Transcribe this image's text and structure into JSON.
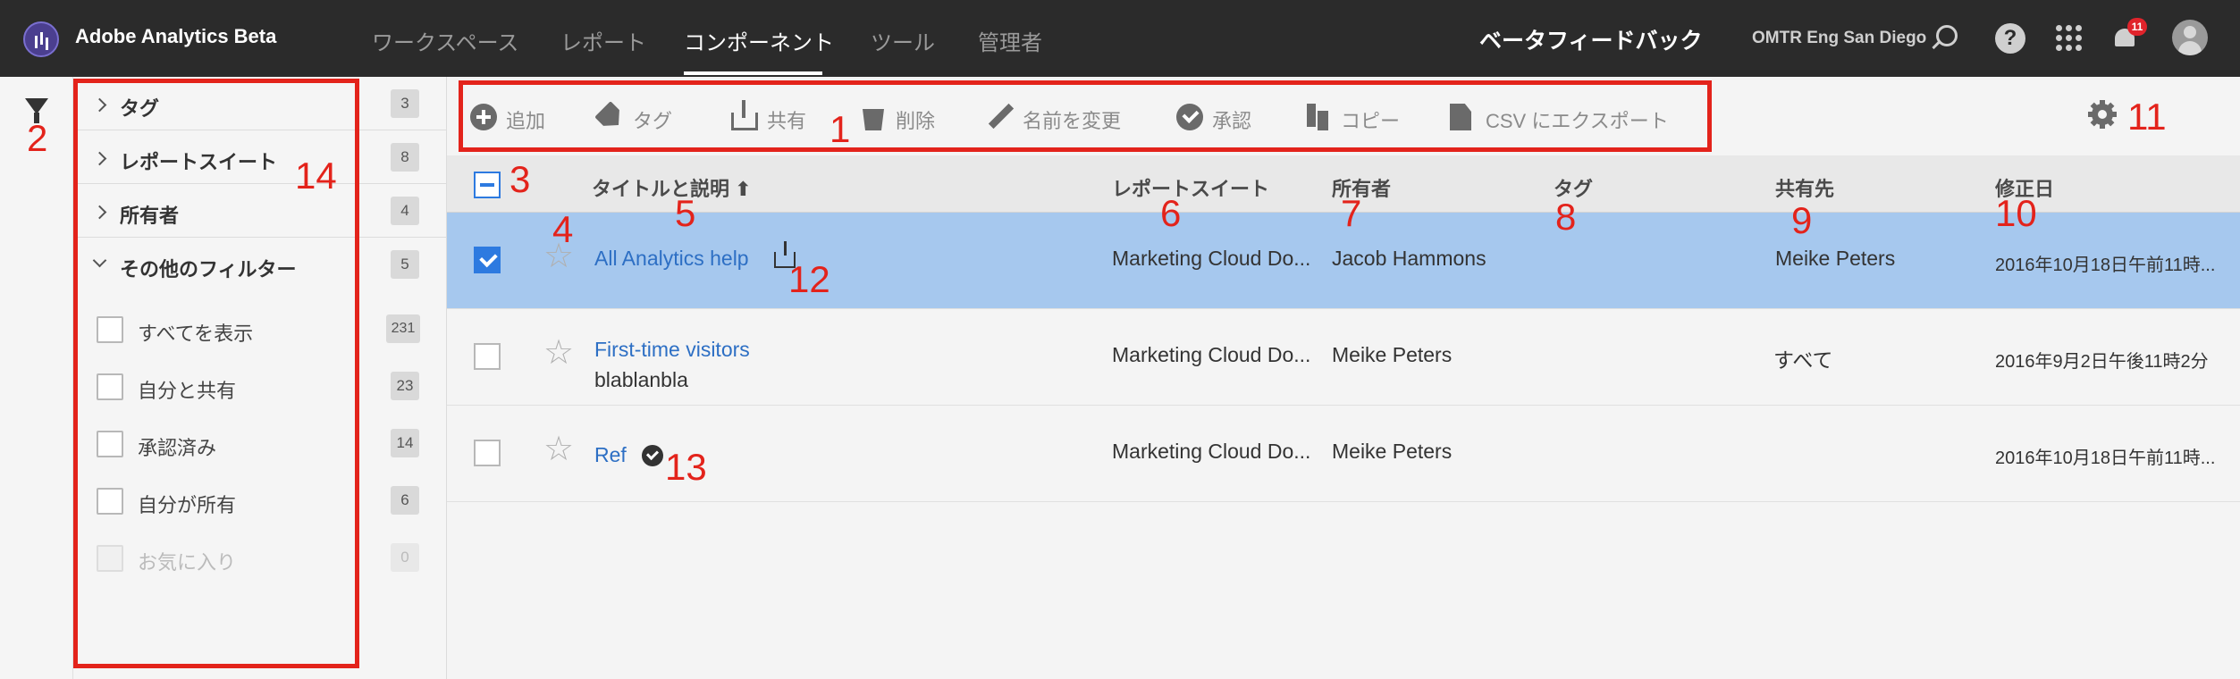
{
  "header": {
    "app_title": "Adobe Analytics Beta",
    "nav": [
      "ワークスペース",
      "レポート",
      "コンポーネント",
      "ツール",
      "管理者"
    ],
    "active_nav": "コンポーネント",
    "feedback": "ベータフィードバック",
    "org": "OMTR Eng San Diego",
    "notification_count": "11",
    "help": "?"
  },
  "sidebar": {
    "sections": [
      {
        "label": "タグ",
        "count": "3"
      },
      {
        "label": "レポートスイート",
        "count": "8"
      },
      {
        "label": "所有者",
        "count": "4"
      },
      {
        "label": "その他のフィルター",
        "count": "5"
      }
    ],
    "filters": [
      {
        "label": "すべてを表示",
        "count": "231"
      },
      {
        "label": "自分と共有",
        "count": "23"
      },
      {
        "label": "承認済み",
        "count": "14"
      },
      {
        "label": "自分が所有",
        "count": "6"
      },
      {
        "label": "お気に入り",
        "count": "0"
      }
    ]
  },
  "toolbar": {
    "add": "追加",
    "tag": "タグ",
    "share": "共有",
    "delete": "削除",
    "rename": "名前を変更",
    "approve": "承認",
    "copy": "コピー",
    "export": "CSV にエクスポート"
  },
  "table": {
    "columns": {
      "title": "タイトルと説明 ⬆",
      "report_suite": "レポートスイート",
      "owner": "所有者",
      "tags": "タグ",
      "shared_with": "共有先",
      "modified": "修正日"
    },
    "rows": [
      {
        "title": "All Analytics help",
        "description": "",
        "report_suite": "Marketing Cloud Do...",
        "owner": "Jacob Hammons",
        "tags": "",
        "shared_with": "Meike Peters",
        "modified": "2016年10月18日午前11時...",
        "selected": true
      },
      {
        "title": "First-time visitors",
        "description": "blablanbla",
        "report_suite": "Marketing Cloud Do...",
        "owner": "Meike Peters",
        "tags": "",
        "shared_with": "すべて",
        "modified": "2016年9月2日午後11時2分",
        "selected": false
      },
      {
        "title": "Ref",
        "description": "",
        "report_suite": "Marketing Cloud Do...",
        "owner": "Meike Peters",
        "tags": "",
        "shared_with": "",
        "modified": "2016年10月18日午前11時...",
        "selected": false
      }
    ]
  },
  "annotations": [
    "1",
    "2",
    "3",
    "4",
    "5",
    "6",
    "7",
    "8",
    "9",
    "10",
    "11",
    "12",
    "13",
    "14"
  ],
  "colors": {
    "accent": "#2d7ae0",
    "selected_row": "#a6c8ee",
    "annotation": "#e3231b",
    "topbar": "#2b2b2b"
  }
}
